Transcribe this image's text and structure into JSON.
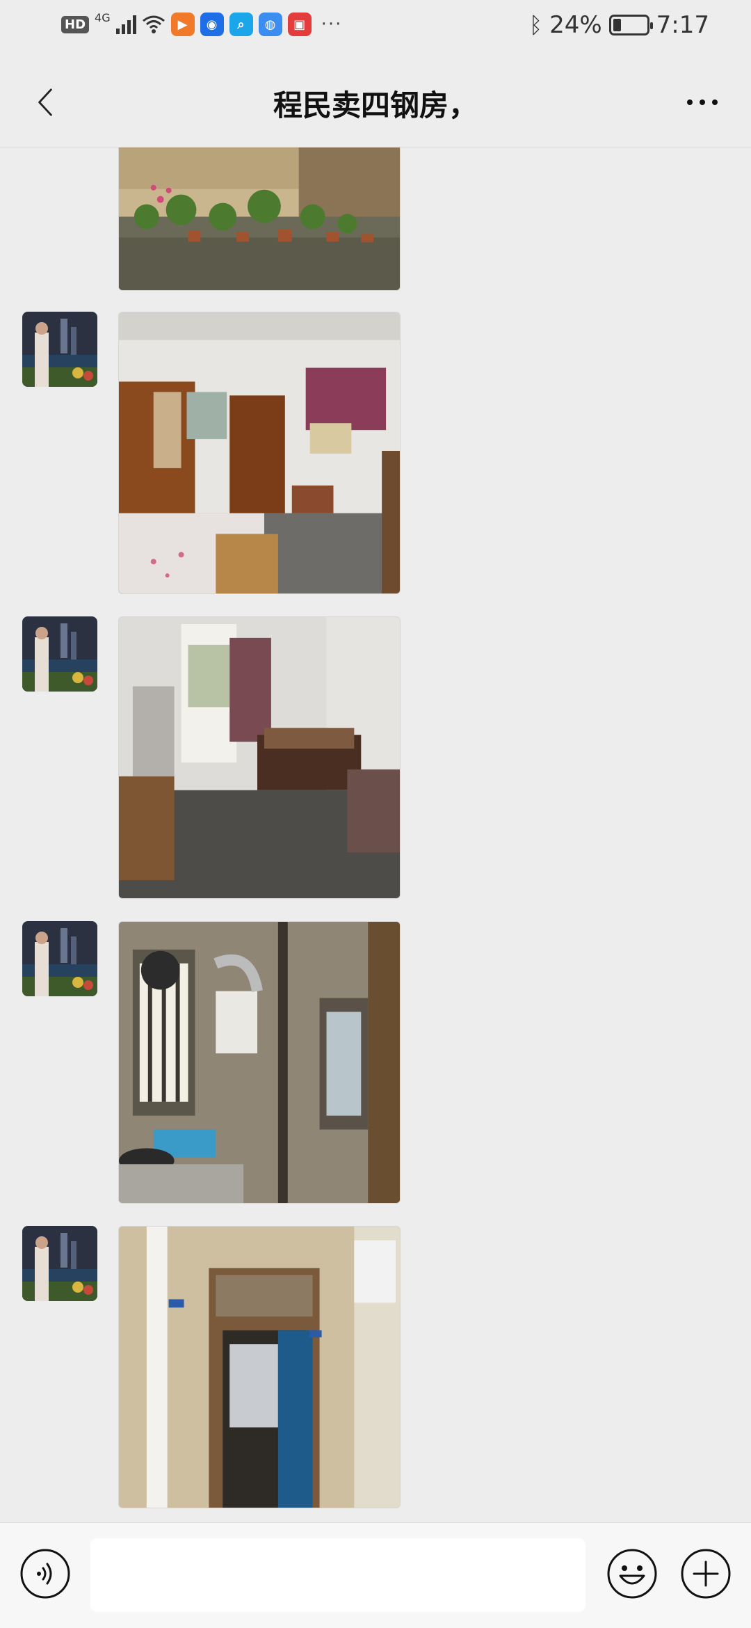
{
  "status_bar": {
    "left_badges": [
      "HD",
      "4G"
    ],
    "battery_percent": "24%",
    "time": "7:17",
    "battery_level": 0.24,
    "app_icons": [
      {
        "name": "play-app-icon",
        "color": "#f07a2a",
        "glyph": "▶"
      },
      {
        "name": "bulb-app-icon",
        "color": "#1e6ee8",
        "glyph": "◉"
      },
      {
        "name": "search-app-icon",
        "color": "#1aa6e8",
        "glyph": "⌕"
      },
      {
        "name": "browser-app-icon",
        "color": "#3b8ef0",
        "glyph": "◍"
      },
      {
        "name": "book-app-icon",
        "color": "#e23c3c",
        "glyph": "▣"
      }
    ],
    "overflow": "···"
  },
  "header": {
    "title": "程民卖四钢房，",
    "back_icon": "chevron-left-icon",
    "more_icon": "more-dots-icon"
  },
  "messages": [
    {
      "type": "image",
      "subject": "outdoor wall with potted plants",
      "show_avatar": false
    },
    {
      "type": "image",
      "subject": "bedroom with wardrobe and window air conditioner",
      "show_avatar": true
    },
    {
      "type": "image",
      "subject": "room with bed and door to balcony",
      "show_avatar": true
    },
    {
      "type": "image",
      "subject": "kitchen with water heater and stove",
      "show_avatar": true
    },
    {
      "type": "image",
      "subject": "hallway with blue door",
      "show_avatar": true
    }
  ],
  "input_bar": {
    "value": "",
    "voice_icon": "voice-icon",
    "emoji_icon": "emoji-icon",
    "plus_icon": "plus-icon"
  },
  "colors": {
    "background": "#ededed",
    "input_bar_bg": "#f7f7f7",
    "title_text": "#111111"
  }
}
